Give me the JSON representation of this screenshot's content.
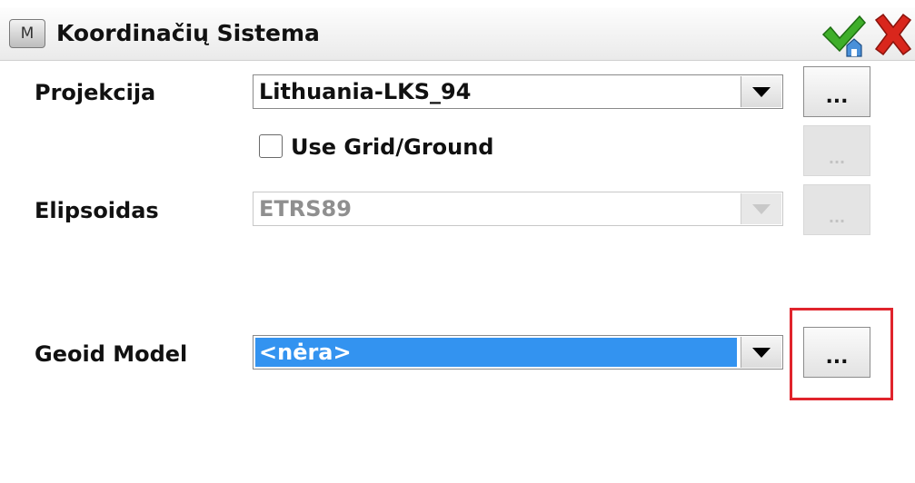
{
  "window": {
    "title": "Koordinačių Sistema",
    "menu_icon_letter": "M"
  },
  "colors": {
    "selection_blue": "#3393f0",
    "annotation_red": "#e0242c",
    "accept_green": "#3fae2a",
    "cancel_red": "#d9261c"
  },
  "form": {
    "projection": {
      "label": "Projekcija",
      "value": "Lithuania-LKS_94",
      "more_label": "..."
    },
    "use_grid_ground": {
      "label": "Use Grid/Ground",
      "checked": false,
      "more_label": "..."
    },
    "ellipsoid": {
      "label": "Elipsoidas",
      "value": "ETRS89",
      "more_label": "..."
    },
    "geoid_model": {
      "label": "Geoid Model",
      "value": "<nėra>",
      "more_label": "..."
    }
  }
}
